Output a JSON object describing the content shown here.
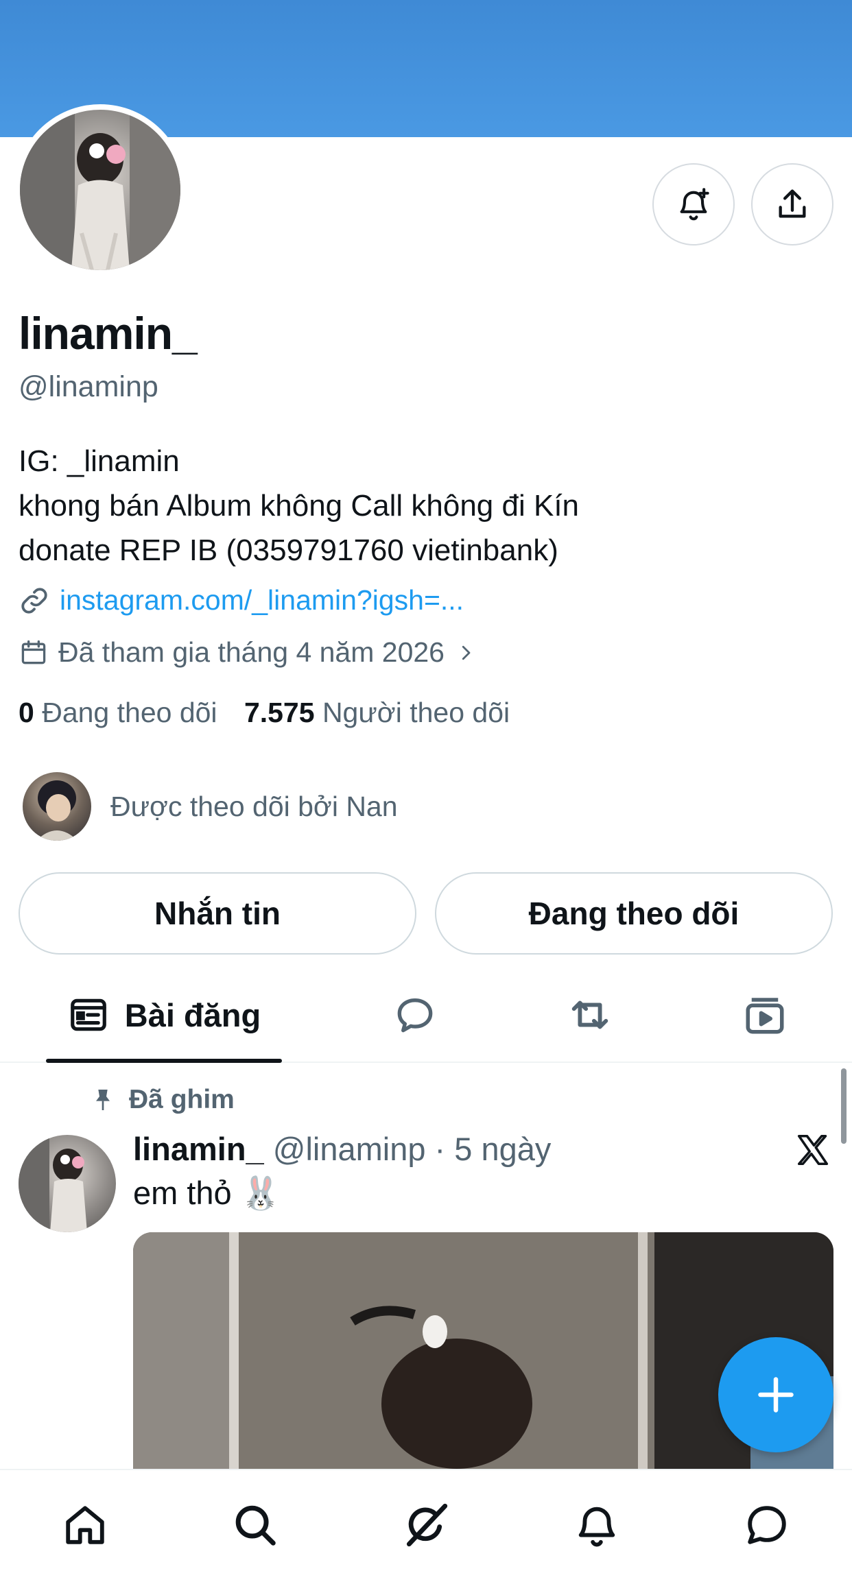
{
  "profile": {
    "display_name": "linamin_",
    "handle": "@linaminp",
    "bio_lines": [
      "IG: _linamin",
      "khong bán Album không Call không đi Kín",
      "donate REP IB (0359791760 vietinbank)"
    ],
    "link": "instagram.com/_linamin?igsh=...",
    "joined": "Đã tham gia tháng 4 năm 2026",
    "following_count": "0",
    "following_label": "Đang theo dõi",
    "followers_count": "7.575",
    "followers_label": "Người theo dõi",
    "followed_by": "Được theo dõi bởi Nan"
  },
  "actions": {
    "message_label": "Nhắn tin",
    "following_button_label": "Đang theo dõi"
  },
  "tabs": [
    {
      "label": "Bài đăng",
      "icon": "posts-icon",
      "active": true
    },
    {
      "label": "",
      "icon": "replies-icon",
      "active": false
    },
    {
      "label": "",
      "icon": "repost-icon",
      "active": false
    },
    {
      "label": "",
      "icon": "media-icon",
      "active": false
    }
  ],
  "post": {
    "pinned_label": "Đã ghim",
    "author_name": "linamin_",
    "author_handle": "@linaminp",
    "separator": "·",
    "time": "5 ngày",
    "text": "em thỏ 🐰"
  },
  "colors": {
    "banner": "#4a99e3",
    "accent": "#1d9bf0",
    "text_primary": "#0f1419",
    "text_secondary": "#536471"
  },
  "bottom_nav": [
    "home-icon",
    "search-icon",
    "grok-icon",
    "notifications-icon",
    "messages-icon"
  ]
}
